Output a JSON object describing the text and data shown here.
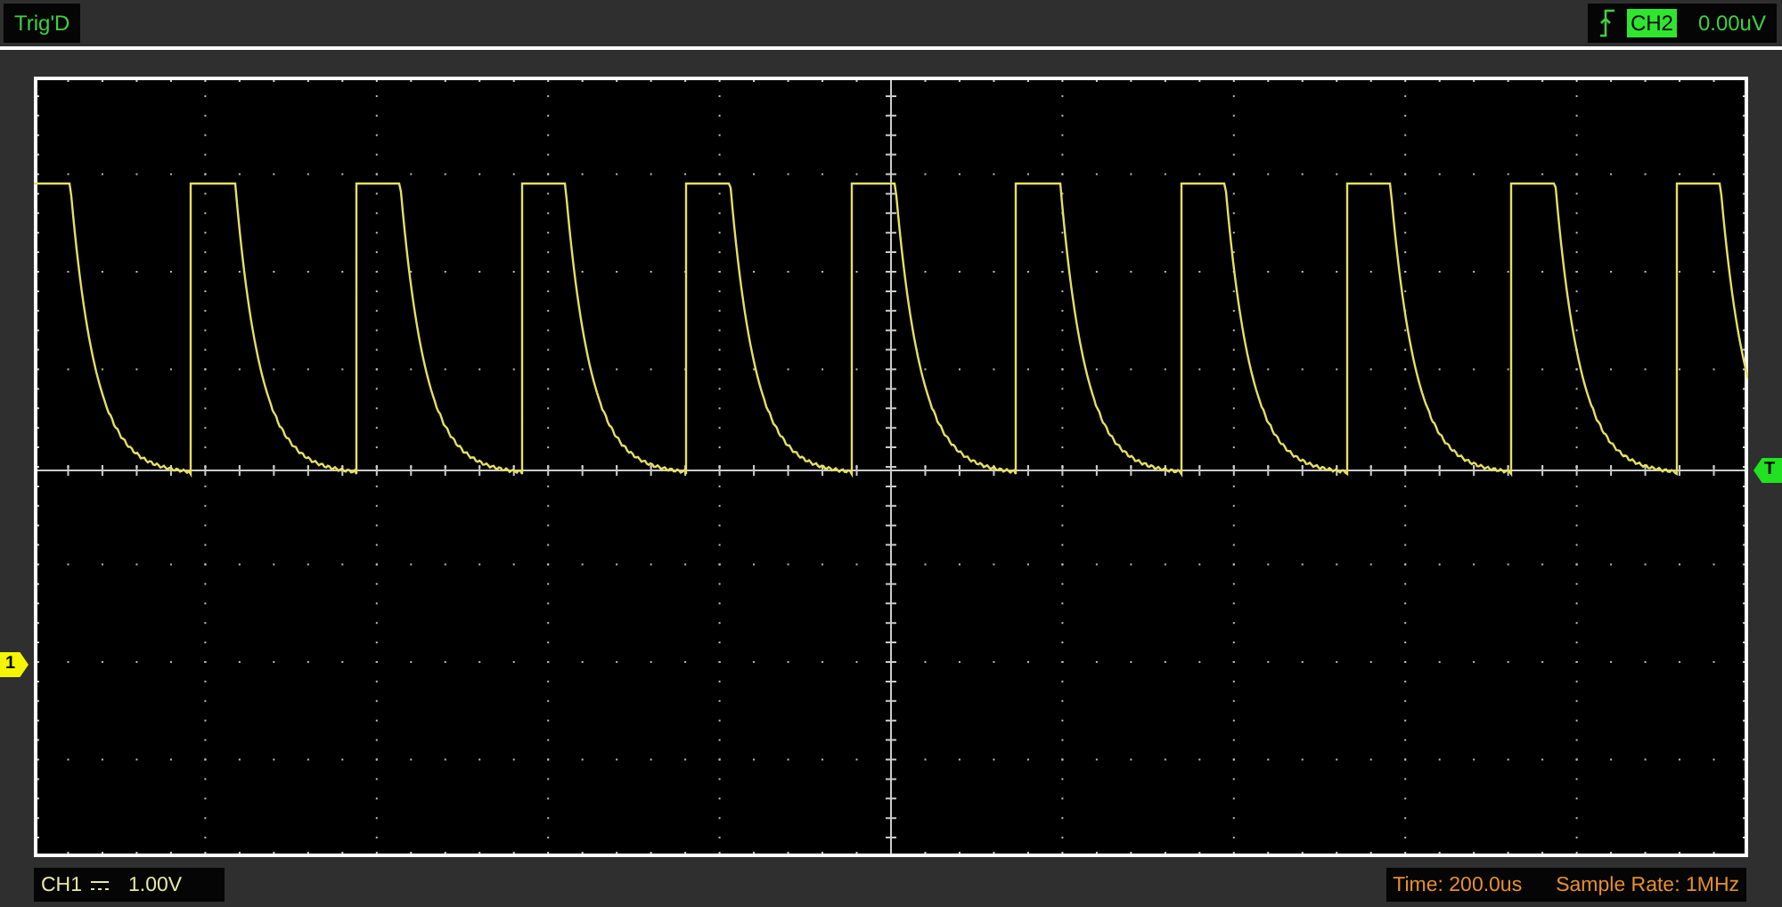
{
  "top_bar": {
    "trigger_status": "Trig'D",
    "trigger_channel": "CH2",
    "trigger_level": "0.00uV"
  },
  "screen": {
    "channel_marker": "1",
    "trigger_marker": "T"
  },
  "bottom_bar": {
    "channel": "CH1",
    "volts_per_div": "1.00V",
    "time_per_div": "Time: 200.0us",
    "sample_rate": "Sample Rate: 1MHz"
  }
}
